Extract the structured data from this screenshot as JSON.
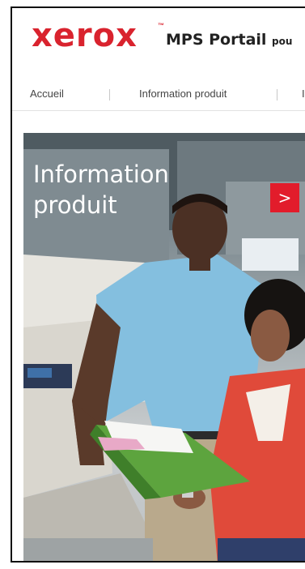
{
  "header": {
    "logo_text": "xerox",
    "logo_tm": "™",
    "portal_title": "MPS Portail",
    "portal_suffix": "pou"
  },
  "nav": {
    "items": [
      {
        "label": "Accueil"
      },
      {
        "label": "Information produit"
      },
      {
        "label": "I"
      }
    ]
  },
  "hero": {
    "title_line1": "Information",
    "title_line2": "produit",
    "arrow": ">"
  },
  "colors": {
    "brand_red": "#d9232e",
    "arrow_red": "#e21c2b"
  }
}
